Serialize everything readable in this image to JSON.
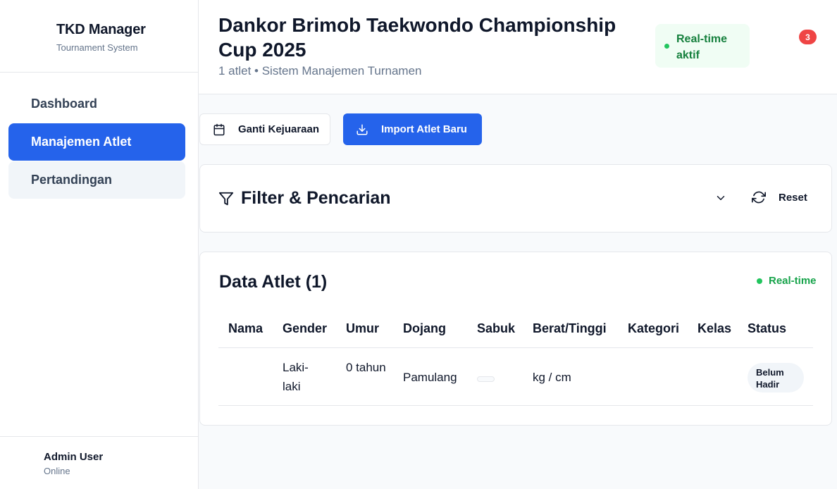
{
  "sidebar": {
    "brand_title": "TKD Manager",
    "brand_subtitle": "Tournament System",
    "items": [
      {
        "label": "Dashboard"
      },
      {
        "label": "Manajemen Atlet"
      },
      {
        "label": "Pertandingan"
      }
    ],
    "user": {
      "name": "Admin User",
      "status": "Online"
    }
  },
  "header": {
    "title": "Dankor Brimob Taekwondo Championship Cup 2025",
    "subtitle": "1 atlet • Sistem Manajemen Turnamen",
    "realtime_badge": "Real-time aktif",
    "notification_count": "3"
  },
  "actions": {
    "change_championship": "Ganti Kejuaraan",
    "import_athletes": "Import Atlet Baru"
  },
  "filter": {
    "title": "Filter & Pencarian",
    "reset_label": "Reset"
  },
  "athletes": {
    "title": "Data Atlet (1)",
    "realtime_label": "Real-time",
    "columns": [
      "Nama",
      "Gender",
      "Umur",
      "Dojang",
      "Sabuk",
      "Berat/Tinggi",
      "Kategori",
      "Kelas",
      "Status"
    ],
    "rows": [
      {
        "nama": "",
        "gender": "Laki-laki",
        "umur": "0 tahun",
        "dojang": "Pamulang",
        "sabuk": "",
        "berat_tinggi": "kg / cm",
        "kategori": "",
        "kelas": "",
        "status": "Belum Hadir"
      }
    ]
  },
  "colors": {
    "primary": "#2563eb",
    "success": "#22c55e",
    "danger": "#ef4444",
    "success_bg": "#f0fdf4"
  }
}
